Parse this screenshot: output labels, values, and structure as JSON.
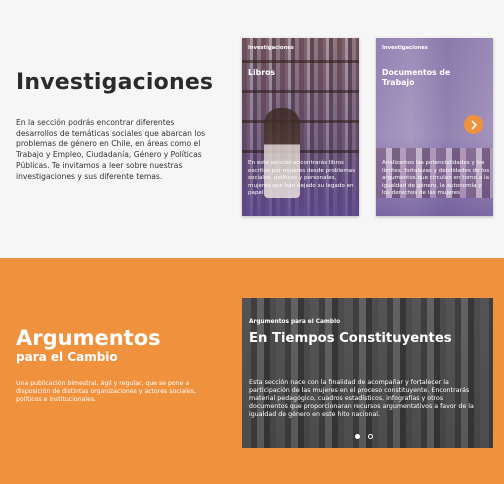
{
  "investigaciones": {
    "title": "Investigaciones",
    "description": "En la sección podrás encontrar diferentes desarrollos de temáticas sociales que abarcan los problemas de género en Chile, en áreas como el Trabajo y Empleo, Ciudadanía, Género y Políticas Públicas. Te invitamos a leer sobre nuestras investigaciones y sus diferente temas.",
    "cards": [
      {
        "tag": "Investigaciones",
        "title": "Libros",
        "text": "En esta sección encontrarás libros escritos por mujeres desde problemas sociales, políticos y personales, mujeres que han dejado su legado en papel"
      },
      {
        "tag": "Investigaciones",
        "title": "Documentos de Trabajo",
        "text": "Analizamos las potencialidades y los límites, fortalezas y debilidades de los argumentos que circulan en torno a la igualdad de género, la autonomía y los derechos de las mujeres"
      }
    ],
    "next_icon": "chevron-right-icon"
  },
  "argumentos": {
    "title": "Argumentos",
    "subtitle": "para el Cambio",
    "description": "Una publicación bimestral, ágil y regular, que se pone a disposición de distintas organizaciones y actores sociales, políticos e institucionales.",
    "feature": {
      "tag": "Argumentos para el Cambio",
      "title": "En Tiempos Constituyentes",
      "text": "Esta sección nace con la finalidad de acompañar y fortalecer la participación de las mujeres en el proceso constituyente. Encontrarás material pedagógico, cuadros estadísticos, infografías y otros documentos que proporcionaran recursos argumentativos a favor de la igualdad de género en este hito nacional."
    },
    "carousel": {
      "total": 2,
      "active": 1
    }
  },
  "colors": {
    "accent": "#f0913e",
    "card_overlay": "#5f4b91",
    "page_bg": "#f6f6f7"
  }
}
